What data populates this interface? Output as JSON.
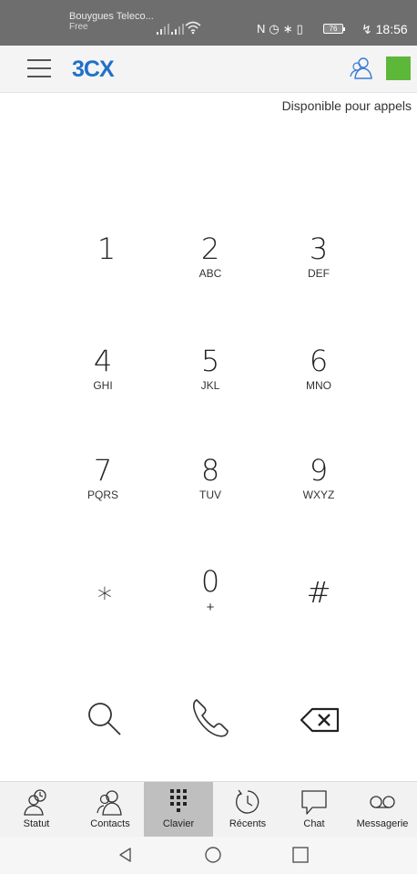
{
  "status_bar": {
    "carrier": "Bouygues Teleco...",
    "carrier_sub": "Free",
    "battery": "76",
    "time": "18:56"
  },
  "header": {
    "logo": "3CX",
    "status_text": "Disponible pour appels",
    "status_color": "#5db83a",
    "accent": "#2070c8"
  },
  "dialpad": {
    "keys": [
      {
        "digit": "1",
        "letters": ""
      },
      {
        "digit": "2",
        "letters": "ABC"
      },
      {
        "digit": "3",
        "letters": "DEF"
      },
      {
        "digit": "4",
        "letters": "GHI"
      },
      {
        "digit": "5",
        "letters": "JKL"
      },
      {
        "digit": "6",
        "letters": "MNO"
      },
      {
        "digit": "7",
        "letters": "PQRS"
      },
      {
        "digit": "8",
        "letters": "TUV"
      },
      {
        "digit": "9",
        "letters": "WXYZ"
      },
      {
        "digit": "∗",
        "letters": ""
      },
      {
        "digit": "0",
        "letters": "+"
      },
      {
        "digit": "#",
        "letters": ""
      }
    ],
    "actions": [
      "search-icon",
      "phone-icon",
      "backspace-icon"
    ]
  },
  "tabs": [
    {
      "label": "Statut",
      "icon": "status-person-icon",
      "active": false
    },
    {
      "label": "Contacts",
      "icon": "contacts-icon",
      "active": false
    },
    {
      "label": "Clavier",
      "icon": "dialpad-icon",
      "active": true
    },
    {
      "label": "Récents",
      "icon": "recent-clock-icon",
      "active": false
    },
    {
      "label": "Chat",
      "icon": "chat-bubble-icon",
      "active": false
    },
    {
      "label": "Messagerie",
      "icon": "voicemail-icon",
      "active": false
    }
  ]
}
